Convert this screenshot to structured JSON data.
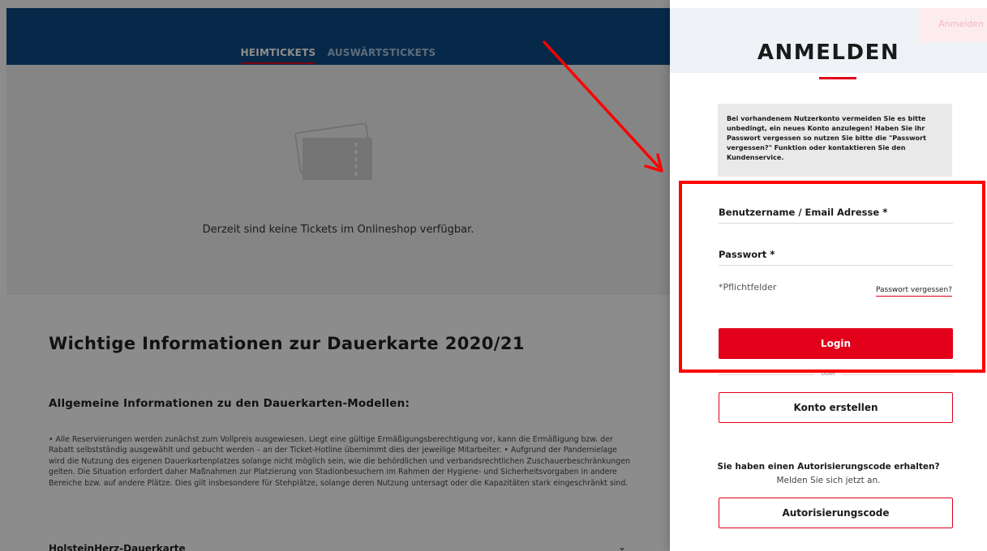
{
  "page": {
    "tabs": [
      {
        "label": "HEIMTICKETS",
        "active": true
      },
      {
        "label": "AUSWÄRTSTICKETS",
        "active": false
      }
    ],
    "no_tickets_message": "Derzeit sind keine Tickets im Onlineshop verfügbar.",
    "info": {
      "title": "Wichtige Informationen zur Dauerkarte 2020/21",
      "subtitle": "Allgemeine Informationen zu den Dauerkarten-Modellen:",
      "body": "• Alle Reservierungen werden zunächst zum Vollpreis ausgewiesen. Liegt eine gültige Ermäßigungsberechtigung vor, kann die Ermäßigung bzw. der Rabatt selbstständig ausgewählt und gebucht werden – an der Ticket-Hotline übernimmt dies der jeweilige Mitarbeiter. • Aufgrund der Pandemielage wird die Nutzung des eigenen Dauerkartenplatzes solange nicht möglich sein, wie die behördlichen und verbandsrechtlichen Zuschauerbeschränkungen gelten. Die Situation erfordert daher Maßnahmen zur Platzierung von Stadionbesuchern im Rahmen der Hygiene- und Sicherheitsvorgaben in andere Bereiche bzw. auf andere Plätze. Dies gilt insbesondere für Stehplätze, solange deren Nutzung untersagt oder die Kapazitäten stark eingeschränkt sind.",
      "accordion_label": "HolsteinHerz-Dauerkarte"
    }
  },
  "drawer": {
    "corner_button": "Anmelden",
    "title": "ANMELDEN",
    "notice": "Bei vorhandenem Nutzerkonto vermeiden Sie es bitte unbedingt, ein neues Konto anzulegen! Haben Sie ihr Passwort vergessen so nutzen Sie bitte die \"Passwort vergessen?\" Funktion oder kontaktieren Sie den Kundenservice.",
    "username_label": "Benutzername / Email Adresse",
    "password_label": "Passwort",
    "required_marker": "*",
    "required_note": "*Pflichtfelder",
    "forgot_password": "Passwort vergessen?",
    "login_button": "Login",
    "or_text": "oder",
    "create_account_button": "Konto erstellen",
    "auth_question": "Sie haben einen Autorisierungscode erhalten?",
    "auth_subtext": "Melden Sie sich jetzt an.",
    "auth_button": "Autorisierungscode"
  },
  "colors": {
    "brand_blue": "#0d4c86",
    "brand_red": "#e2001a",
    "annotation_red": "#ff0000"
  },
  "icons": [
    "ticket-icon",
    "chevron-down-icon",
    "annotation-arrow"
  ]
}
